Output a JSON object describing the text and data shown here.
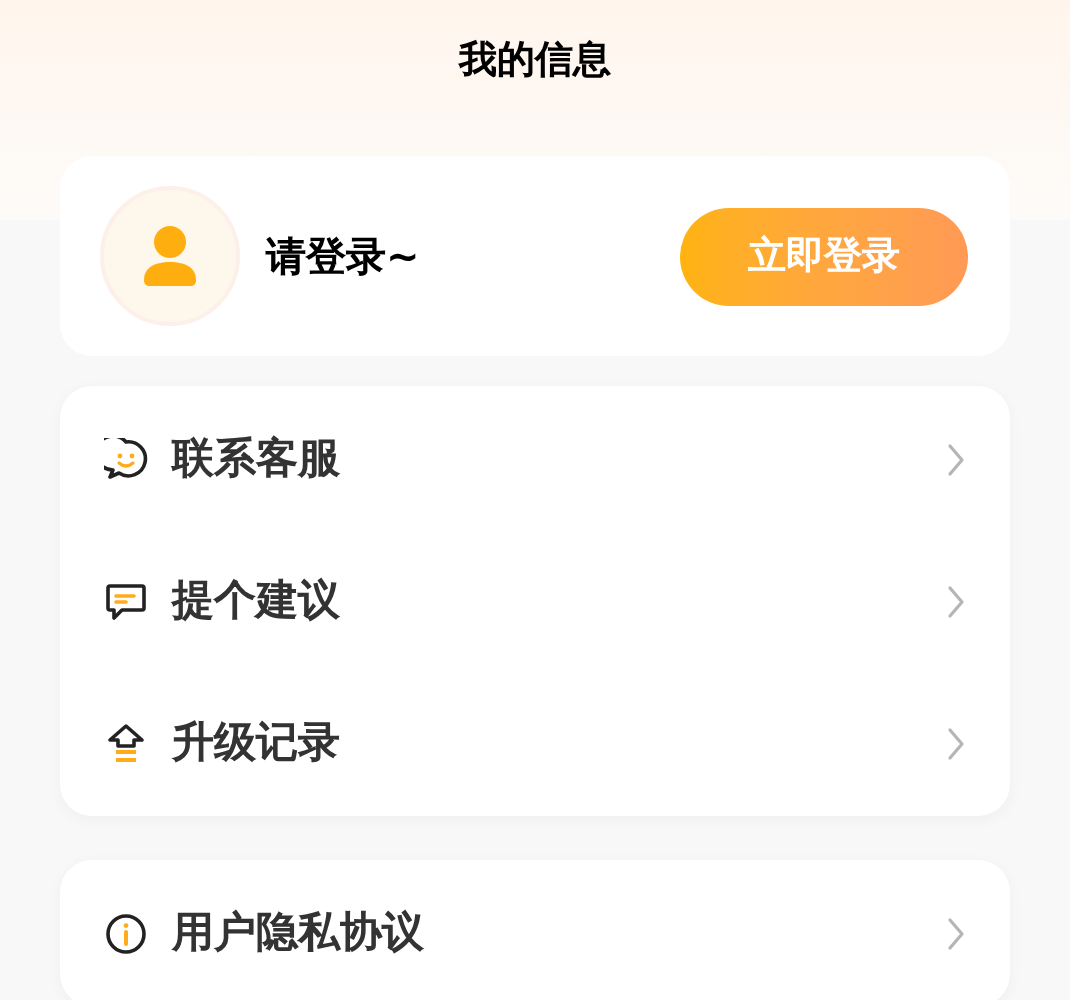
{
  "header": {
    "title": "我的信息"
  },
  "profile": {
    "name": "请登录~",
    "login_button": "立即登录"
  },
  "menu_groups": [
    {
      "items": [
        {
          "kind": "smile",
          "label": "联系客服"
        },
        {
          "kind": "comment",
          "label": "提个建议"
        },
        {
          "kind": "upgrade",
          "label": "升级记录"
        }
      ]
    },
    {
      "items": [
        {
          "kind": "info",
          "label": "用户隐私协议"
        }
      ]
    }
  ]
}
